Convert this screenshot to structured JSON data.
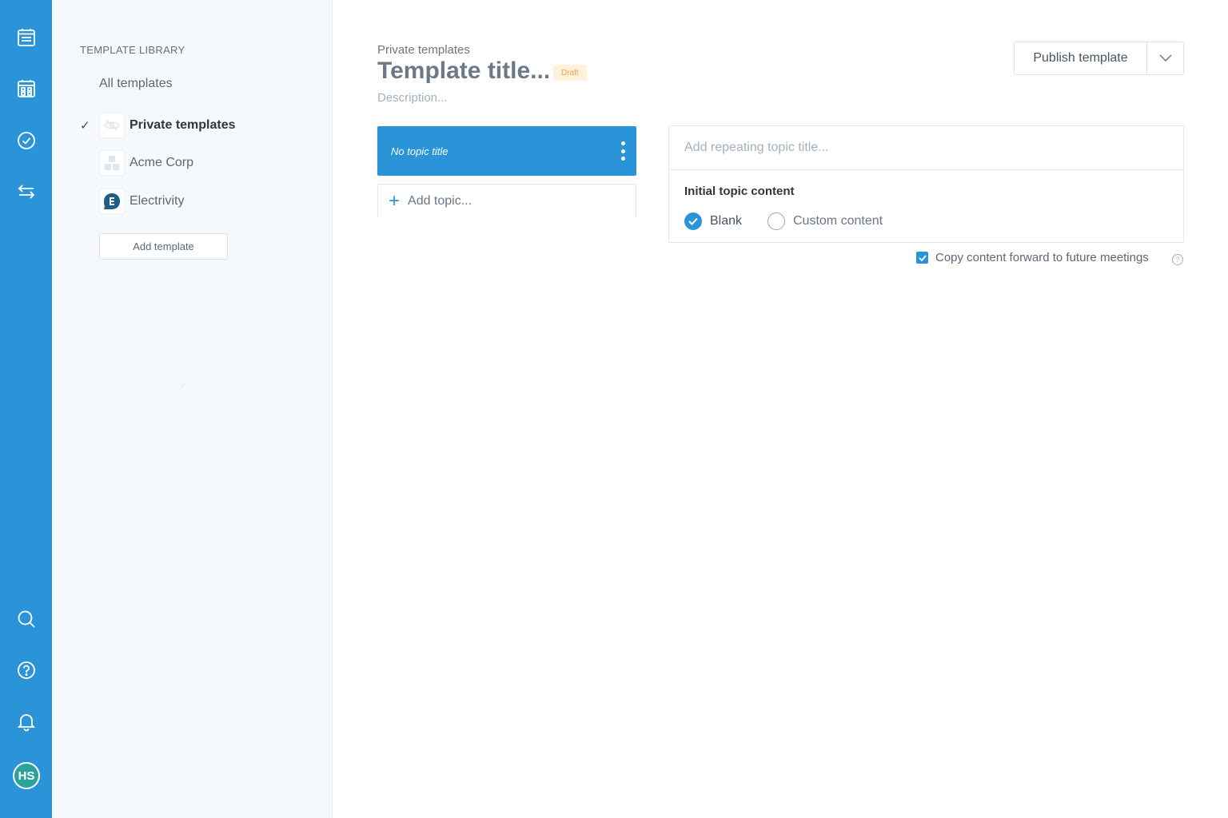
{
  "rail": {
    "avatar_initials": "HS"
  },
  "library": {
    "heading": "TEMPLATE LIBRARY",
    "all_label": "All templates",
    "items": [
      {
        "label": "Private templates",
        "selected": true
      },
      {
        "label": "Acme Corp",
        "selected": false
      },
      {
        "label": "Electrivity",
        "selected": false
      }
    ],
    "add_button": "Add template"
  },
  "header": {
    "breadcrumb": "Private templates",
    "title": "Template title...",
    "badge": "Draft",
    "description": "Description...",
    "publish_label": "Publish template"
  },
  "topics": {
    "selected_title": "No topic title",
    "add_label": "Add topic..."
  },
  "topic_panel": {
    "repeat_placeholder": "Add repeating topic title...",
    "initial_label": "Initial topic content",
    "options": [
      {
        "label": "Blank",
        "checked": true
      },
      {
        "label": "Custom content",
        "checked": false
      }
    ],
    "copy_forward_label": "Copy content forward to future meetings",
    "copy_forward_checked": true
  },
  "colors": {
    "brand_blue": "#2b94d8",
    "avatar_teal": "#2aa39a",
    "draft_bg": "#fff1dc",
    "draft_text": "#f0a24a"
  }
}
